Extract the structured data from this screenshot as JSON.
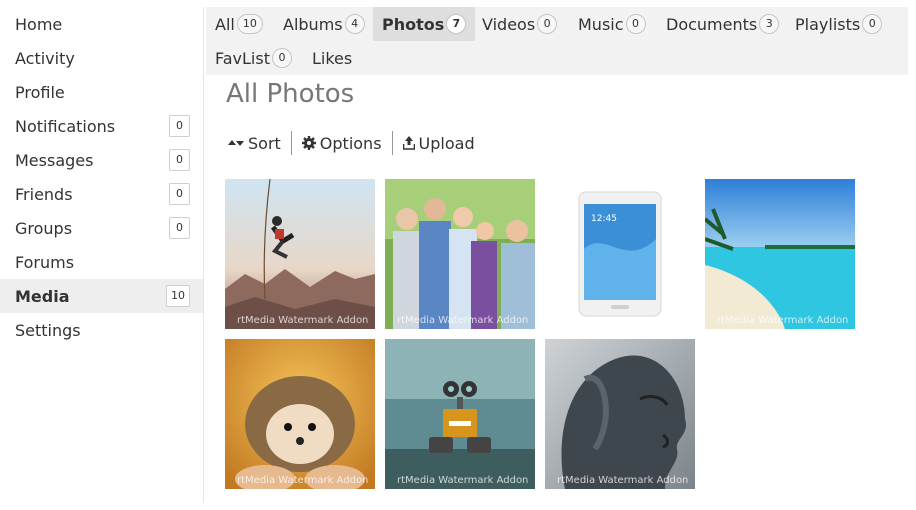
{
  "sidebar": {
    "items": [
      {
        "label": "Home"
      },
      {
        "label": "Activity"
      },
      {
        "label": "Profile"
      },
      {
        "label": "Notifications",
        "count": "0"
      },
      {
        "label": "Messages",
        "count": "0"
      },
      {
        "label": "Friends",
        "count": "0"
      },
      {
        "label": "Groups",
        "count": "0"
      },
      {
        "label": "Forums"
      },
      {
        "label": "Media",
        "count": "10",
        "active": true
      },
      {
        "label": "Settings"
      }
    ]
  },
  "tabs": [
    {
      "label": "All",
      "count": "10"
    },
    {
      "label": "Albums",
      "count": "4"
    },
    {
      "label": "Photos",
      "count": "7",
      "active": true
    },
    {
      "label": "Videos",
      "count": "0"
    },
    {
      "label": "Music",
      "count": "0"
    },
    {
      "label": "Documents",
      "count": "3"
    },
    {
      "label": "Playlists",
      "count": "0"
    },
    {
      "label": "FavList",
      "count": "0"
    },
    {
      "label": "Likes"
    }
  ],
  "page_title": "All Photos",
  "toolbar": {
    "sort_label": "Sort",
    "options_label": "Options",
    "upload_label": "Upload"
  },
  "photos": [
    {
      "subject": "rock climber",
      "watermark": "rtMedia Watermark Addon"
    },
    {
      "subject": "family portrait",
      "watermark": "rtMedia Watermark Addon"
    },
    {
      "subject": "tablet",
      "watermark": ""
    },
    {
      "subject": "tropical beach",
      "watermark": "rtMedia Watermark Addon"
    },
    {
      "subject": "hedgehog",
      "watermark": "rtMedia Watermark Addon"
    },
    {
      "subject": "robot toy",
      "watermark": "rtMedia Watermark Addon"
    },
    {
      "subject": "stone face sculpture",
      "watermark": "rtMedia Watermark Addon"
    }
  ],
  "colors": {
    "sidebar_active_bg": "#eeeeee",
    "tabs_bg": "#f2f2f2",
    "tab_active_bg": "#dedede",
    "title_color": "#777777"
  }
}
